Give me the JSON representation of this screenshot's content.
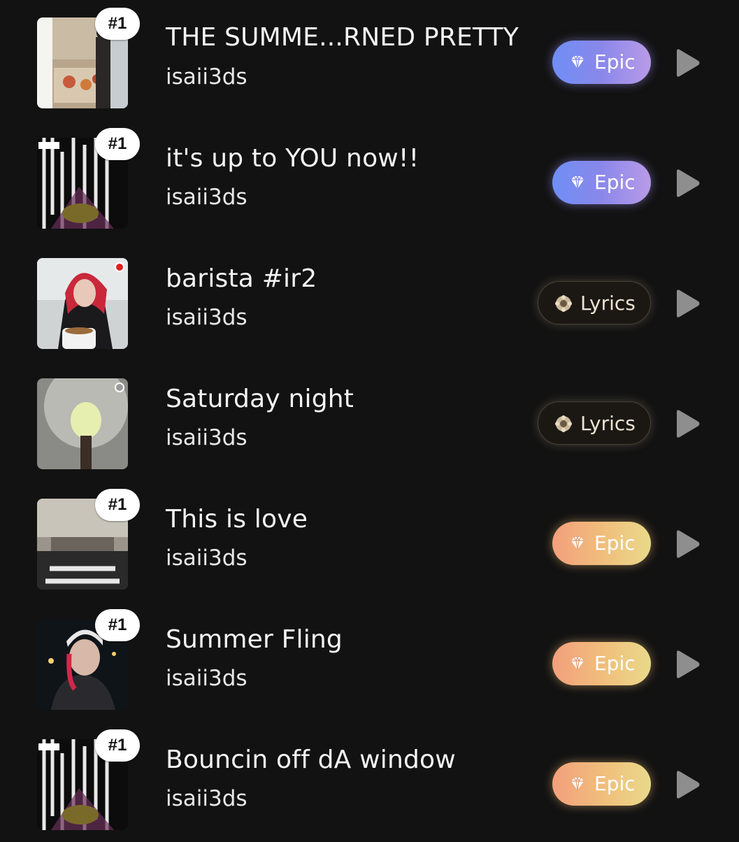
{
  "tracks": [
    {
      "title": "THE SUMME...RNED PRETTY",
      "artist": "isaii3ds",
      "rank": "#1",
      "tag": {
        "label": "Epic",
        "style": "epic-blue",
        "icon": "diamond-icon"
      },
      "cover_icon": "photo-icon"
    },
    {
      "title": "it's up to YOU now!!",
      "artist": "isaii3ds",
      "rank": "#1",
      "tag": {
        "label": "Epic",
        "style": "epic-blue",
        "icon": "diamond-icon"
      },
      "cover_icon": "photo-icon"
    },
    {
      "title": "barista #ir2",
      "artist": "isaii3ds",
      "rank": "",
      "tag": {
        "label": "Lyrics",
        "style": "lyrics",
        "icon": "ornament-icon"
      },
      "cover_icon": "photo-icon",
      "dot_color": "#e02020"
    },
    {
      "title": "Saturday night",
      "artist": "isaii3ds",
      "rank": "",
      "tag": {
        "label": "Lyrics",
        "style": "lyrics",
        "icon": "ornament-icon"
      },
      "cover_icon": "photo-icon",
      "dot_color": "#9a9a9a"
    },
    {
      "title": "This is love",
      "artist": "isaii3ds",
      "rank": "#1",
      "tag": {
        "label": "Epic",
        "style": "epic-orange",
        "icon": "diamond-icon"
      },
      "cover_icon": "photo-icon"
    },
    {
      "title": "Summer Fling",
      "artist": "isaii3ds",
      "rank": "#1",
      "tag": {
        "label": "Epic",
        "style": "epic-orange",
        "icon": "diamond-icon"
      },
      "cover_icon": "photo-icon"
    },
    {
      "title": "Bouncin off dA window",
      "artist": "isaii3ds",
      "rank": "#1",
      "tag": {
        "label": "Epic",
        "style": "epic-orange",
        "icon": "diamond-icon"
      },
      "cover_icon": "photo-icon"
    }
  ],
  "colors": {
    "background": "#121212",
    "play_icon": "#8e8e8e",
    "epic_blue": "#7f8cf0",
    "epic_orange": "#f0b07c",
    "lyrics_bg": "#1b1814"
  }
}
